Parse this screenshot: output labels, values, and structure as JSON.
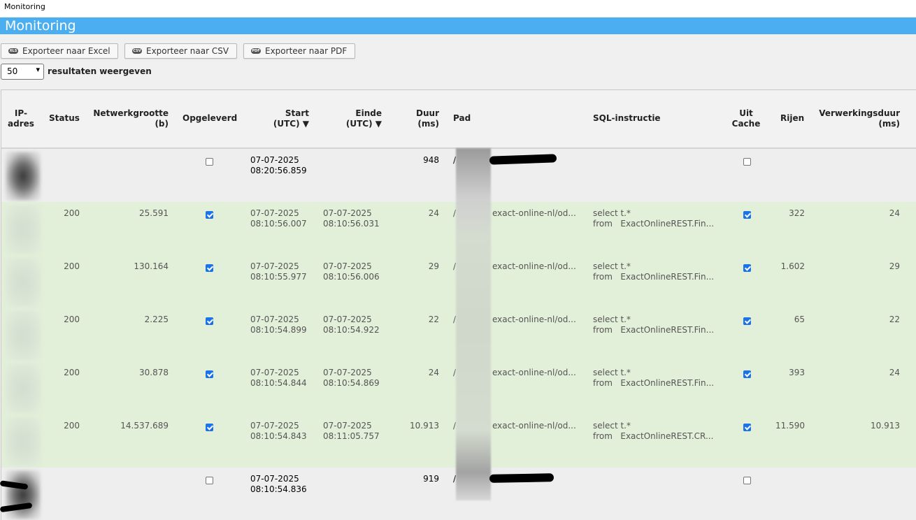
{
  "window_title": "Monitoring",
  "page_title": "Monitoring",
  "export_buttons": [
    {
      "icon": "XLS",
      "label": "Exporteer naar Excel"
    },
    {
      "icon": "CSV",
      "label": "Exporteer naar CSV"
    },
    {
      "icon": "PDF",
      "label": "Exporteer naar PDF"
    }
  ],
  "page_size": {
    "value": "50",
    "label": "resultaten weergeven"
  },
  "columns": {
    "ip": "IP-\nadres",
    "status": "Status",
    "size": "Netwerkgrootte\n(b)",
    "delivered": "Opgeleverd",
    "start": "Start\n(UTC) ▼",
    "end": "Einde\n(UTC) ▼",
    "duration": "Duur\n(ms)",
    "path": "Pad",
    "sql": "SQL-instructie",
    "cache": "Uit\nCache",
    "rows": "Rijen",
    "processing": "Verwerkingsduur\n(ms)"
  },
  "rows": [
    {
      "state": "pending",
      "status": "",
      "size": "",
      "delivered": false,
      "start": "07-07-2025\n08:20:56.859",
      "end": "",
      "duration": "948",
      "path_prefix": "/",
      "path": "/od...",
      "sql": "",
      "cache": false,
      "rows": "",
      "processing": ""
    },
    {
      "state": "ok",
      "status": "200",
      "size": "25.591",
      "delivered": true,
      "start": "07-07-2025\n08:10:56.007",
      "end": "07-07-2025\n08:10:56.031",
      "duration": "24",
      "path_prefix": "/",
      "path": "exact-online-nl/od...",
      "sql": "select t.*\nfrom   ExactOnlineREST.Fin...",
      "cache": true,
      "rows": "322",
      "processing": "24"
    },
    {
      "state": "ok",
      "status": "200",
      "size": "130.164",
      "delivered": true,
      "start": "07-07-2025\n08:10:55.977",
      "end": "07-07-2025\n08:10:56.006",
      "duration": "29",
      "path_prefix": "/",
      "path": "exact-online-nl/od...",
      "sql": "select t.*\nfrom   ExactOnlineREST.Fin...",
      "cache": true,
      "rows": "1.602",
      "processing": "29"
    },
    {
      "state": "ok",
      "status": "200",
      "size": "2.225",
      "delivered": true,
      "start": "07-07-2025\n08:10:54.899",
      "end": "07-07-2025\n08:10:54.922",
      "duration": "22",
      "path_prefix": "/",
      "path": "exact-online-nl/od...",
      "sql": "select t.*\nfrom   ExactOnlineREST.Fin...",
      "cache": true,
      "rows": "65",
      "processing": "22"
    },
    {
      "state": "ok",
      "status": "200",
      "size": "30.878",
      "delivered": true,
      "start": "07-07-2025\n08:10:54.844",
      "end": "07-07-2025\n08:10:54.869",
      "duration": "24",
      "path_prefix": "/",
      "path": "exact-online-nl/od...",
      "sql": "select t.*\nfrom   ExactOnlineREST.Fin...",
      "cache": true,
      "rows": "393",
      "processing": "24"
    },
    {
      "state": "ok",
      "status": "200",
      "size": "14.537.689",
      "delivered": true,
      "start": "07-07-2025\n08:10:54.843",
      "end": "07-07-2025\n08:11:05.757",
      "duration": "10.913",
      "path_prefix": "/",
      "path": "exact-online-nl/od...",
      "sql": "select t.*\nfrom   ExactOnlineREST.CR...",
      "cache": true,
      "rows": "11.590",
      "processing": "10.913"
    },
    {
      "state": "pending",
      "status": "",
      "size": "",
      "delivered": false,
      "start": "07-07-2025\n08:10:54.836",
      "end": "",
      "duration": "919",
      "path_prefix": "/",
      "path": "l/od...",
      "sql": "",
      "cache": false,
      "rows": "",
      "processing": ""
    }
  ]
}
